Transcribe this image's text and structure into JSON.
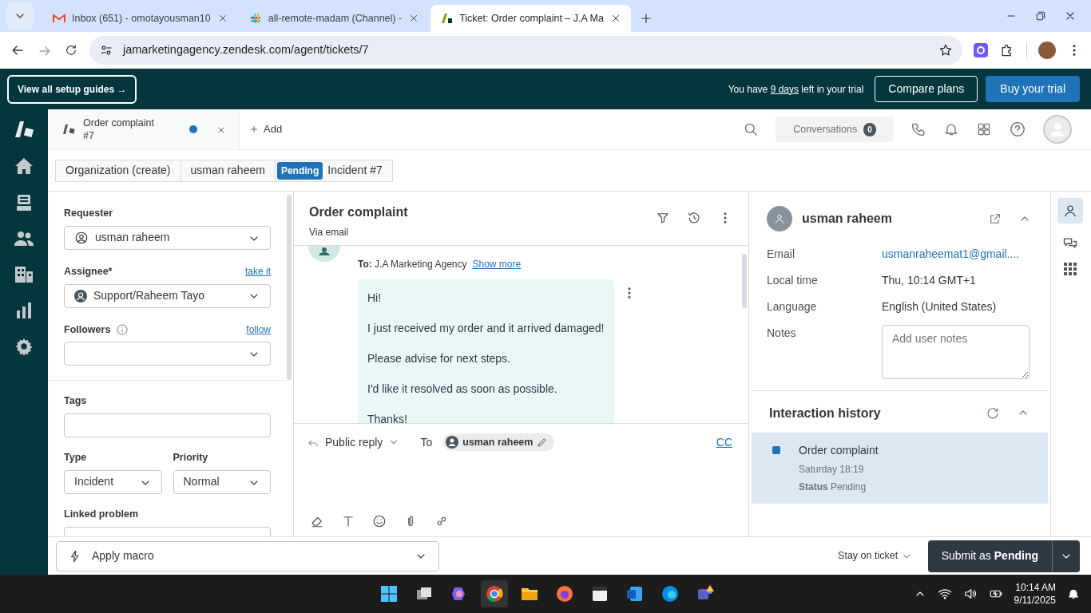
{
  "browser": {
    "tabs": [
      {
        "title": "Inbox (651) - omotayousman10",
        "kind": "mail",
        "selected": false
      },
      {
        "title": "all-remote-madam (Channel) -",
        "kind": "chat",
        "selected": false
      },
      {
        "title": "Ticket: Order complaint – J.A Ma",
        "kind": "desk",
        "selected": true
      }
    ],
    "url": "jamarketingagency.zendesk.com/agent/tickets/7"
  },
  "banner": {
    "guides_button": "View all setup guides →",
    "message_start": "You have",
    "days_link": "9 days",
    "message_end": "left in your trial",
    "compare_button": "Compare plans",
    "buy_button": "Buy your trial"
  },
  "ticket_tab": {
    "title": "Order complaint",
    "number": "#7",
    "unsaved": true
  },
  "add_tab": "Add",
  "conversations": {
    "label": "Conversations",
    "count": "0"
  },
  "breadcrumbs": [
    {
      "label": "Organization (create)"
    },
    {
      "label": "usman raheem"
    },
    {
      "badge": "Pending",
      "label": "Incident #7"
    }
  ],
  "form": {
    "requester": {
      "label": "Requester",
      "value": "usman raheem"
    },
    "assignee": {
      "label": "Assignee*",
      "link": "take it",
      "value": "Support/Raheem Tayo"
    },
    "followers": {
      "label": "Followers",
      "link": "follow"
    },
    "tags": {
      "label": "Tags"
    },
    "type": {
      "label": "Type",
      "value": "Incident"
    },
    "priority": {
      "label": "Priority",
      "value": "Normal"
    },
    "linked_problem": {
      "label": "Linked problem"
    }
  },
  "conversation": {
    "title": "Order complaint",
    "channel": "Via email",
    "to_label": "To:",
    "to": "J.A Marketing Agency",
    "show_more": "Show more",
    "paragraphs": [
      "Hi!",
      "I just received my order and it arrived damaged!",
      "Please advise for next steps.",
      "I'd like it resolved as soon as possible.",
      "Thanks!"
    ]
  },
  "reply": {
    "mode": "Public reply",
    "to_label": "To",
    "recipient": "usman raheem",
    "cc": "CC"
  },
  "user": {
    "name": "usman raheem",
    "fields": [
      {
        "label": "Email",
        "value": "usmanraheemat1@gmail....",
        "kind": "link"
      },
      {
        "label": "Local time",
        "value": "Thu, 10:14 GMT+1",
        "kind": "text"
      },
      {
        "label": "Language",
        "value": "English (United States)",
        "kind": "text"
      },
      {
        "label": "Notes",
        "placeholder": "Add user notes",
        "kind": "notes"
      }
    ]
  },
  "history": {
    "title": "Interaction history",
    "items": [
      {
        "title": "Order complaint",
        "time": "Saturday 18:19",
        "status_label": "Status",
        "status": "Pending",
        "color": "#1f73b7",
        "selected": true
      }
    ]
  },
  "footer": {
    "macro": "Apply macro",
    "stay": "Stay on ticket",
    "submit": "Submit as **Pending**"
  },
  "taskbar": {
    "time": "10:14 AM",
    "date": "9/11/2025"
  }
}
